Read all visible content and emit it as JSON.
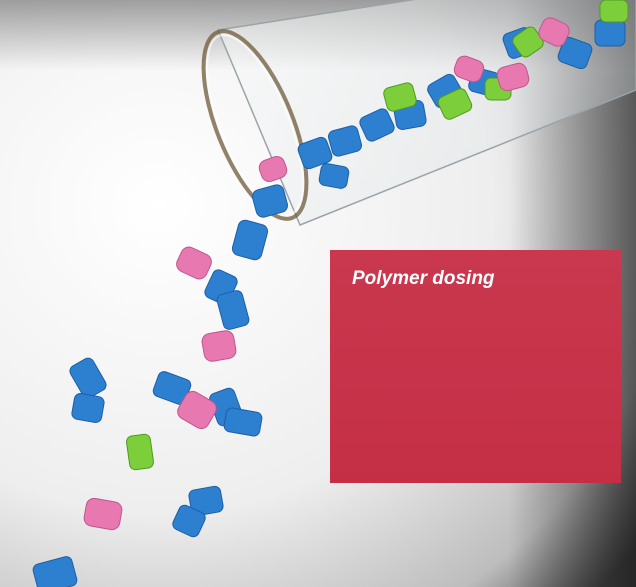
{
  "caption": {
    "title": "Polymer dosing"
  },
  "colors": {
    "caption_background": "#c8354b",
    "caption_text": "#ffffff",
    "pellet_blue": "#2d7fd0",
    "pellet_pink": "#e779b0",
    "pellet_green": "#7ccf3a"
  },
  "photo": {
    "subject-icons": [
      "test-tube-icon",
      "polymer-pellet-icon"
    ]
  }
}
